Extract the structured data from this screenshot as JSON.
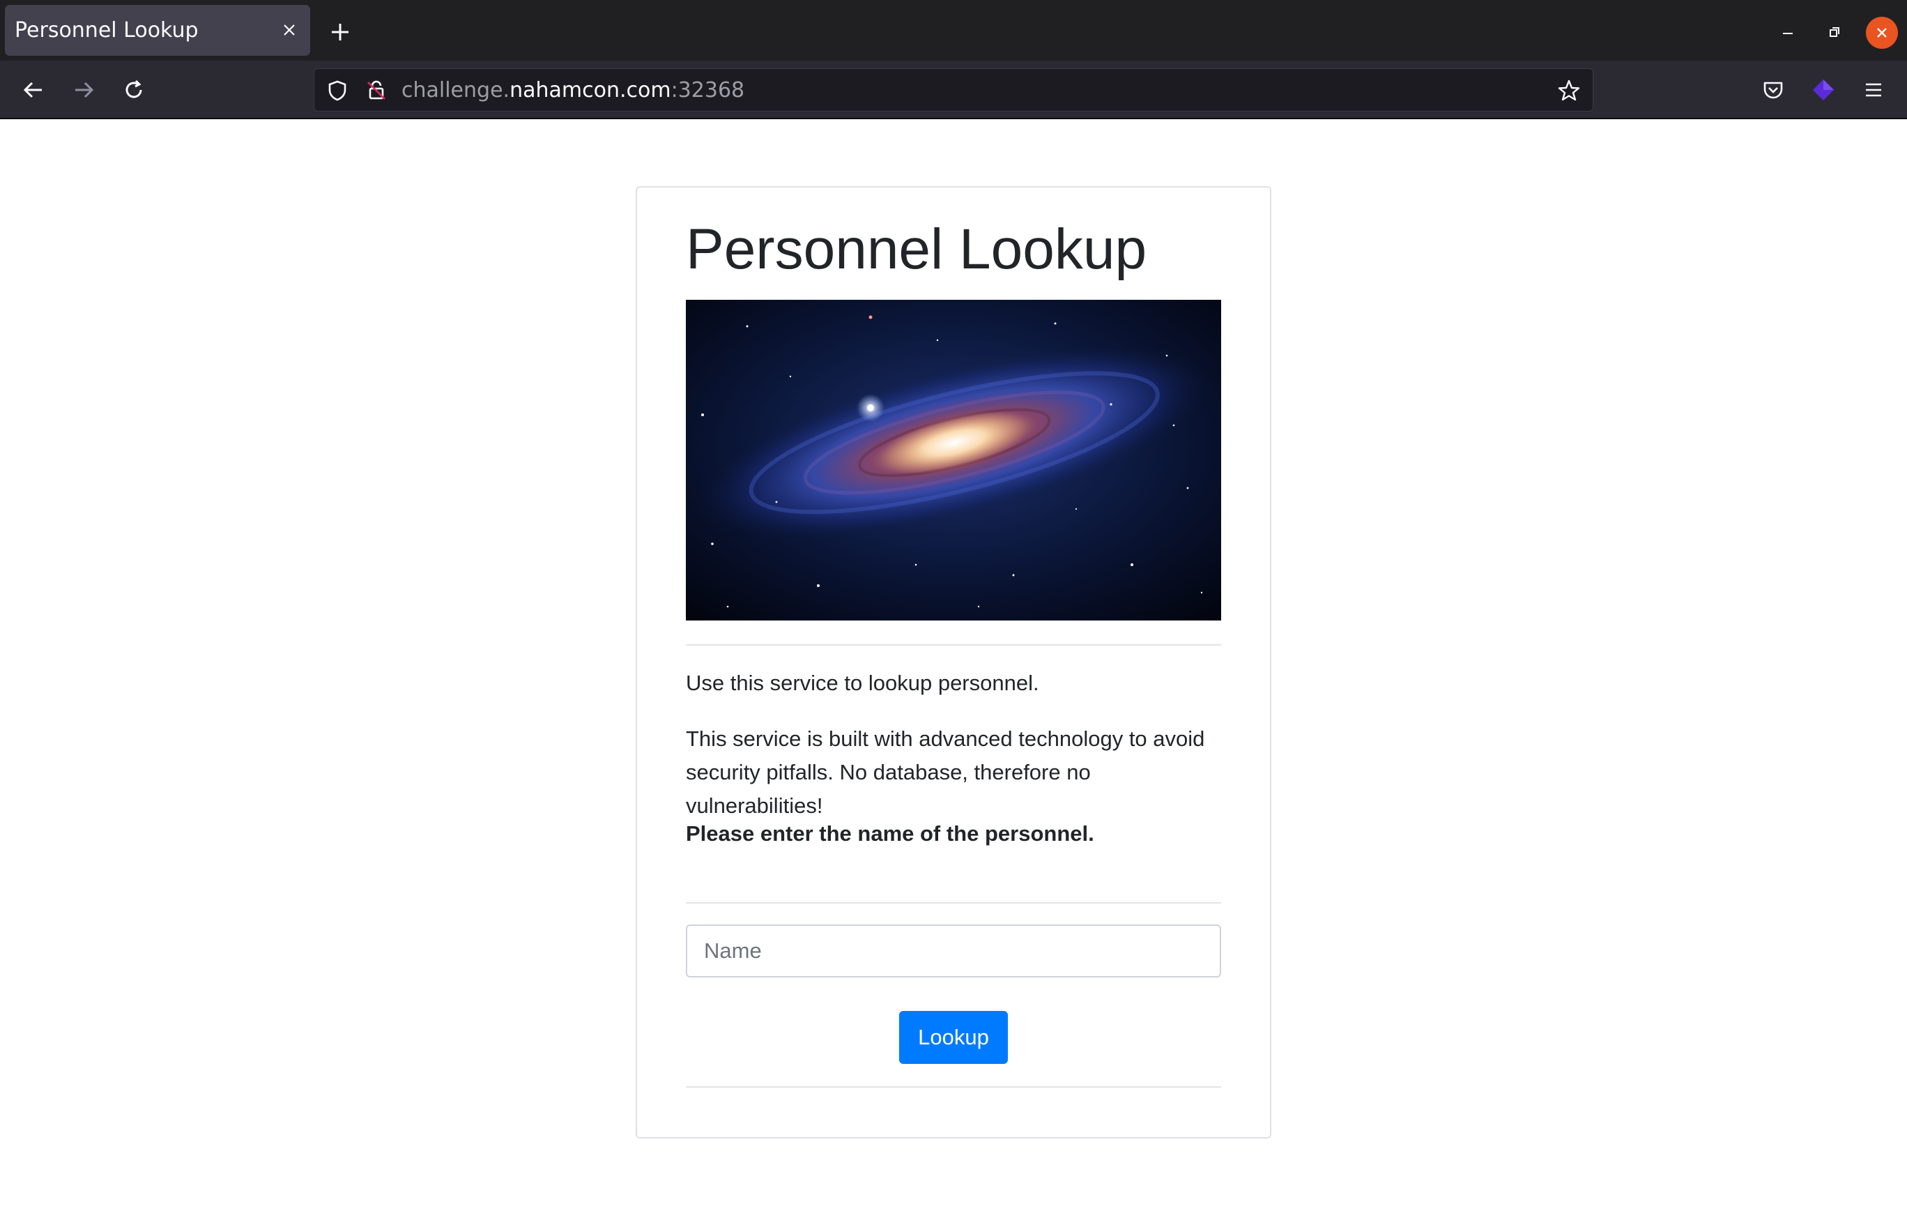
{
  "browser": {
    "tab_title": "Personnel Lookup",
    "url_prefix": "challenge.",
    "url_host": "nahamcon.com",
    "url_port": ":32368"
  },
  "page": {
    "title": "Personnel Lookup",
    "intro": "Use this service to lookup personnel.",
    "description": "This service is built with advanced technology to avoid security pitfalls. No database, therefore no vulnerabilities!",
    "prompt": "Please enter the name of the personnel.",
    "name_placeholder": "Name",
    "name_value": "",
    "button_label": "Lookup"
  },
  "colors": {
    "accent": "#007bff",
    "window_close": "#e95420"
  },
  "icons": [
    "close-icon",
    "plus-icon",
    "minimize-icon",
    "restore-icon",
    "back-arrow-icon",
    "forward-arrow-icon",
    "reload-icon",
    "shield-icon",
    "lock-icon",
    "star-icon",
    "pocket-icon",
    "extension-icon",
    "hamburger-menu-icon"
  ]
}
